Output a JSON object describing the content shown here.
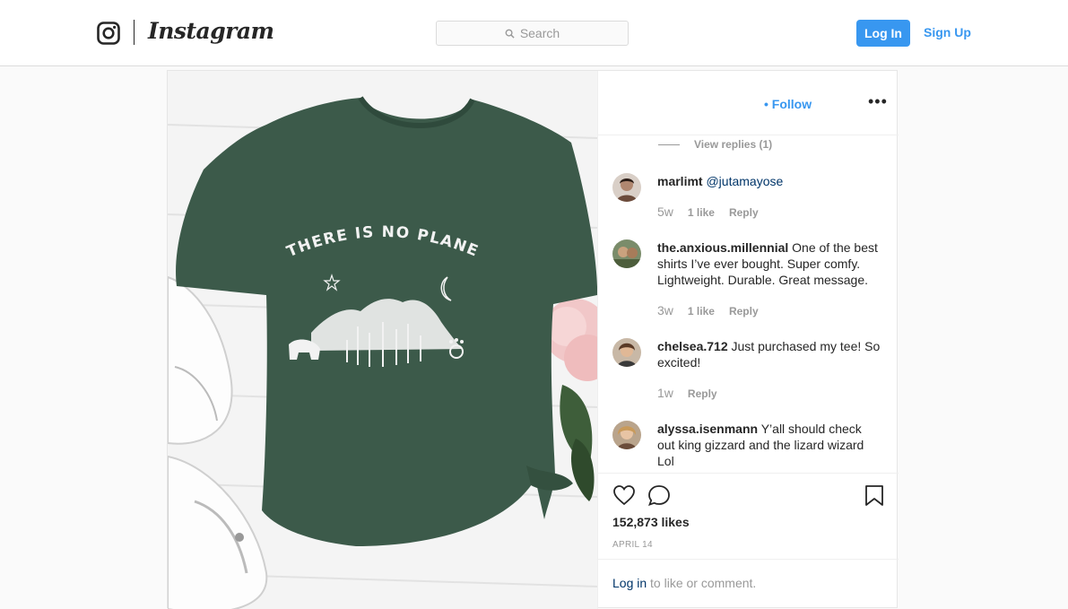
{
  "header": {
    "brand": "Instagram",
    "search_placeholder": "Search",
    "login_label": "Log In",
    "signup_label": "Sign Up"
  },
  "post": {
    "photo": {
      "shirt_text": "THERE IS NO PLANET B",
      "shirt_color": "#3c5a4a"
    },
    "follow_label": "• Follow",
    "more_label": "•••",
    "view_replies": "View replies (1)",
    "comments": [
      {
        "user": "marlimt",
        "mention": "@jutamayose",
        "text": "",
        "time": "5w",
        "likes": "1 like",
        "reply": "Reply"
      },
      {
        "user": "the.anxious.millennial",
        "mention": "",
        "text": "One of the best shirts I’ve ever bought. Super comfy. Lightweight. Durable. Great message.",
        "time": "3w",
        "likes": "1 like",
        "reply": "Reply"
      },
      {
        "user": "chelsea.712",
        "mention": "",
        "text": "Just purchased my tee! So excited!",
        "time": "1w",
        "likes": "",
        "reply": "Reply"
      },
      {
        "user": "alyssa.isenmann",
        "mention": "",
        "text": "Y’all should check out king gizzard and the lizard wizard Lol",
        "time": "",
        "likes": "",
        "reply": ""
      }
    ],
    "likes": "152,873 likes",
    "date": "APRIL 14",
    "login_prompt_link": "Log in",
    "login_prompt_text": "to like or comment."
  },
  "colors": {
    "accent": "#3897f0",
    "mention": "#003569",
    "muted": "#999999"
  },
  "icons": [
    "instagram-glyph-icon",
    "search-icon",
    "heart-icon",
    "comment-icon",
    "bookmark-icon",
    "more-icon"
  ]
}
